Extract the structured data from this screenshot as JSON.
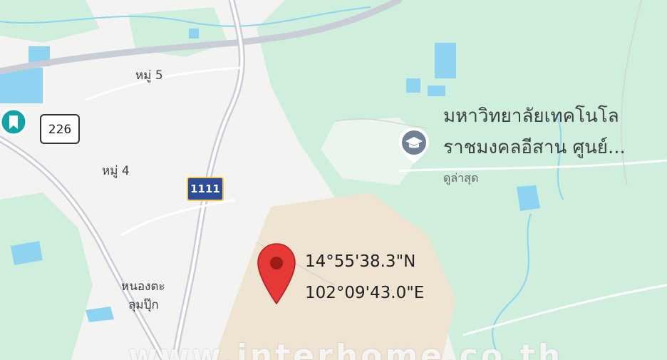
{
  "map": {
    "villages": [
      {
        "text": "หมู่ 5"
      },
      {
        "text": "หมู่ 4"
      },
      {
        "text": "หนองตะ"
      },
      {
        "text": "ลุมปุ๊ก"
      }
    ],
    "road_shields": {
      "route_226": "226",
      "route_1111": "1111"
    },
    "poi": {
      "name_line1": "มหาวิทยาลัยเทคโนโล",
      "name_line2": "ราชมงคลอีสาน ศูนย์...",
      "subtitle": "ดูล่าสุด",
      "icon": "graduation-cap-icon"
    },
    "pin": {
      "latitude": "14°55'38.3\"N",
      "longitude": "102°09'43.0\"E",
      "color": "#e53935"
    },
    "saved_place_icon": "bookmark-icon",
    "watermark": "www.interhome.co.th",
    "colors": {
      "land": "#f3f3f1",
      "green": "#cfeedb",
      "water": "#8ed3f0",
      "road": "#c9ced6",
      "sand": "#efe4d2"
    }
  }
}
